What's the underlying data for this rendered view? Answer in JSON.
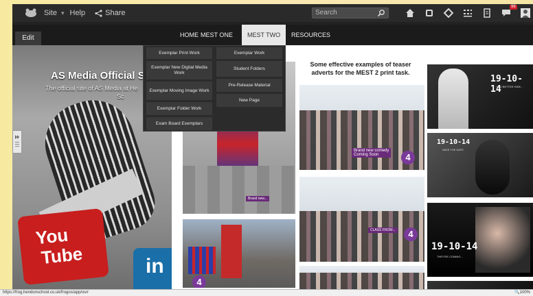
{
  "topbar": {
    "site_label": "Site",
    "help_label": "Help",
    "share_label": "Share",
    "search_placeholder": "Search",
    "notification_count": "98",
    "icons": [
      "home-icon",
      "frog-icon",
      "settings-icon",
      "grid-icon",
      "archive-icon",
      "messages-icon",
      "user-icon"
    ]
  },
  "nav": {
    "edit_label": "Edit",
    "items": [
      {
        "label": "HOME"
      },
      {
        "label": "MEST ONE"
      },
      {
        "label": "MEST TWO"
      },
      {
        "label": "RESOURCES"
      }
    ]
  },
  "hero": {
    "title": "AS Media Official S",
    "subtitle": "The official site of AS Media at He",
    "subtitle_tail": "Sc",
    "youtube_you": "You",
    "youtube_tube": "Tube",
    "linkedin": "in"
  },
  "dropdown": {
    "left_column": [
      "Exemplar Print Work",
      "Exemplar New Digital Media Work",
      "Exemplar Moving Image Work",
      "Exemplar Folder Work",
      "Exam Board Exemplars"
    ],
    "right_column": [
      "Exemplar Work",
      "Student Folders",
      "Pre-Release Material",
      "New Page"
    ]
  },
  "content": {
    "caption": "Some effective examples of teaser adverts for the MEST 2 print task.",
    "promo_1": "Brand new comedy",
    "promo_1_sub": "Coming Soon",
    "date_1": "19-10-14",
    "date_1_sub": "YOU BETTER HIDE...",
    "date_2": "19-10-14",
    "date_2_sub": "SAVE THE DATE",
    "date_3": "19-10-14",
    "date_3_sub": "THEY'RE COMING...",
    "four": "4"
  },
  "statusbar": {
    "url": "https://frog.hendonschool.co.uk/frogos/app/os#",
    "zoom": "100%"
  },
  "colors": {
    "nav_bg": "#1b1b1b",
    "active_tab": "#e8e8e8",
    "channel4_purple": "#7a3a9a",
    "youtube_red": "#c81e1e",
    "linkedin_blue": "#1a6fa8"
  }
}
